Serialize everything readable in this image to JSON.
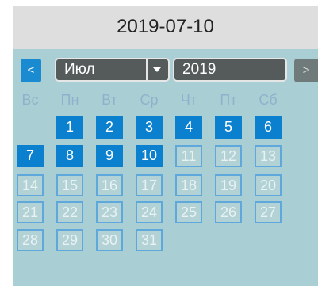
{
  "header": {
    "title": "2019-07-10"
  },
  "nav": {
    "prev_label": "<",
    "next_label": ">"
  },
  "month_select": {
    "value": "Июл"
  },
  "year_select": {
    "value": "2019"
  },
  "weekdays": [
    "Вс",
    "Пн",
    "Вт",
    "Ср",
    "Чт",
    "Пт",
    "Сб"
  ],
  "days": [
    "1",
    "2",
    "3",
    "4",
    "5",
    "6",
    "7",
    "8",
    "9",
    "10",
    "11",
    "12",
    "13",
    "14",
    "15",
    "16",
    "17",
    "18",
    "19",
    "20",
    "21",
    "22",
    "23",
    "24",
    "25",
    "26",
    "27",
    "28",
    "29",
    "30",
    "31"
  ],
  "selected_day": "10",
  "colors": {
    "accent": "#0b80cf",
    "header_bg": "#dedede",
    "panel_bg": "#a9cfd4"
  }
}
